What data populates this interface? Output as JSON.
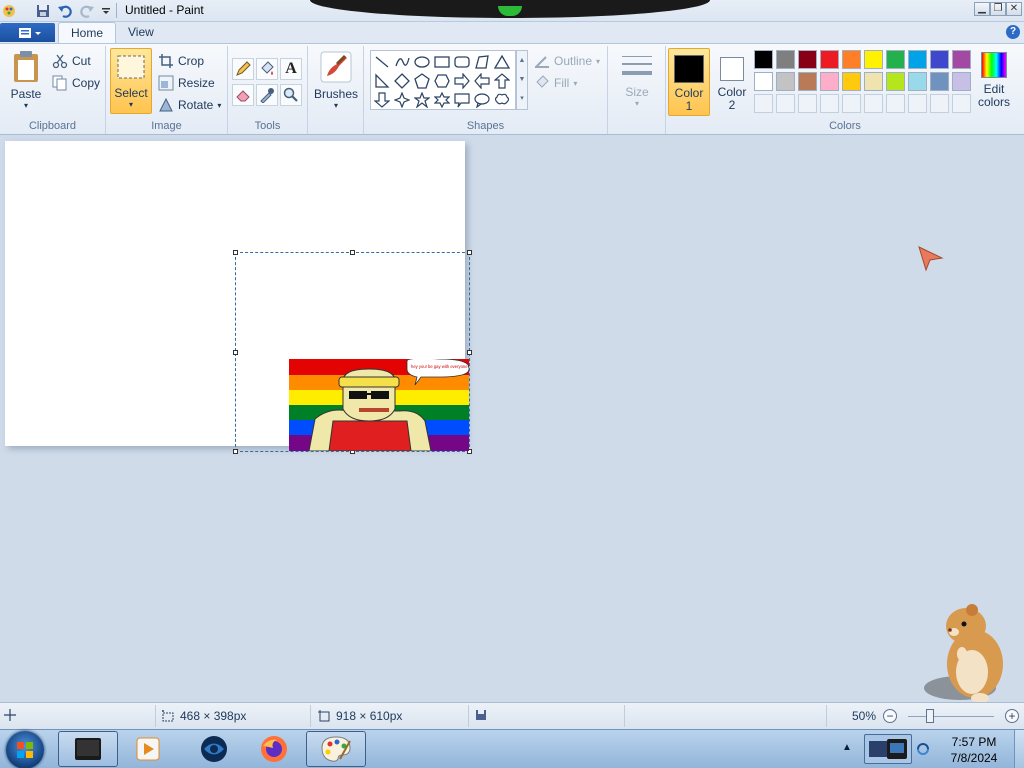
{
  "window": {
    "title": "Untitled - Paint",
    "controls": [
      "minimize",
      "restore",
      "close"
    ]
  },
  "quick_access": [
    "paint-app-icon",
    "save-icon",
    "undo-icon",
    "redo-icon",
    "customize-icon"
  ],
  "tabs": [
    {
      "label": "Home",
      "active": true
    },
    {
      "label": "View",
      "active": false
    }
  ],
  "ribbon": {
    "clipboard": {
      "group_label": "Clipboard",
      "paste": "Paste",
      "cut": "Cut",
      "copy": "Copy"
    },
    "image": {
      "group_label": "Image",
      "select": "Select",
      "crop": "Crop",
      "resize": "Resize",
      "rotate": "Rotate"
    },
    "tools": {
      "group_label": "Tools",
      "items": [
        "pencil-icon",
        "fill-icon",
        "text-icon",
        "eraser-icon",
        "color-picker-icon",
        "magnifier-icon"
      ]
    },
    "brushes": {
      "label": "Brushes"
    },
    "shapes": {
      "group_label": "Shapes",
      "outline": "Outline",
      "fill": "Fill"
    },
    "size": {
      "label": "Size"
    },
    "colors": {
      "group_label": "Colors",
      "color1_label": "Color",
      "color1_num": "1",
      "color2_label": "Color",
      "color2_num": "2",
      "edit_label": "Edit",
      "edit_label2": "colors",
      "color1": "#000000",
      "color2": "#ffffff",
      "palette_row1": [
        "#000000",
        "#7f7f7f",
        "#880015",
        "#ed1c24",
        "#ff7f27",
        "#fff200",
        "#22b14c",
        "#00a2e8",
        "#3f48cc",
        "#a349a4"
      ],
      "palette_row2": [
        "#ffffff",
        "#c3c3c3",
        "#b97a57",
        "#ffaec9",
        "#ffc90e",
        "#efe4b0",
        "#b5e61d",
        "#99d9ea",
        "#7092be",
        "#c8bfe7"
      ]
    }
  },
  "canvas": {
    "speech_bubble": "hey you! be gay with everyone!"
  },
  "statusbar": {
    "selection_size": "468 × 398px",
    "image_size": "918 × 610px",
    "zoom": "50%",
    "zoom_level": 0.5
  },
  "taskbar": {
    "time": "7:57 PM",
    "date": "7/8/2024",
    "apps": [
      "terminal-app",
      "media-player-app",
      "browser-app",
      "firefox-app",
      "paint-app"
    ]
  }
}
